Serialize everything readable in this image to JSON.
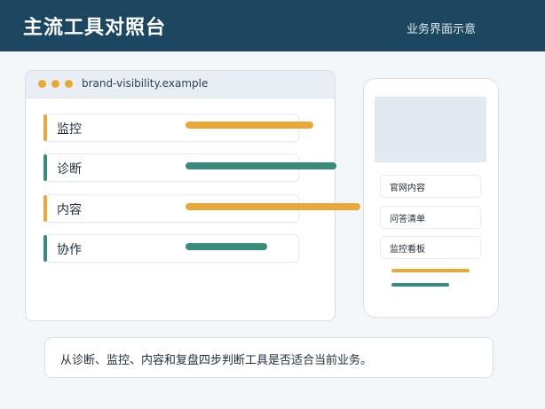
{
  "header": {
    "title": "主流工具对照台",
    "subtitle": "业务界面示意"
  },
  "browser": {
    "url": "brand-visibility.example",
    "rows": [
      {
        "label": "监控",
        "color": "#e9a93a",
        "level": 0.82
      },
      {
        "label": "诊断",
        "color": "#3b8a7e",
        "level": 1.0
      },
      {
        "label": "内容",
        "color": "#e9a93a",
        "level": 1.15
      },
      {
        "label": "协作",
        "color": "#3b8a7e",
        "level": 0.53
      }
    ]
  },
  "phone": {
    "items": [
      "官网内容",
      "问答清单",
      "监控看板"
    ],
    "lines": [
      {
        "color": "#e9a93a",
        "level": 1.0
      },
      {
        "color": "#3b8a7e",
        "level": 0.74
      }
    ]
  },
  "note": "从诊断、监控、内容和复盘四步判断工具是否适合当前业务。",
  "colors": {
    "header_bg": "#1d4660",
    "accent_orange": "#e9a93a",
    "accent_teal": "#3b8a7e"
  }
}
